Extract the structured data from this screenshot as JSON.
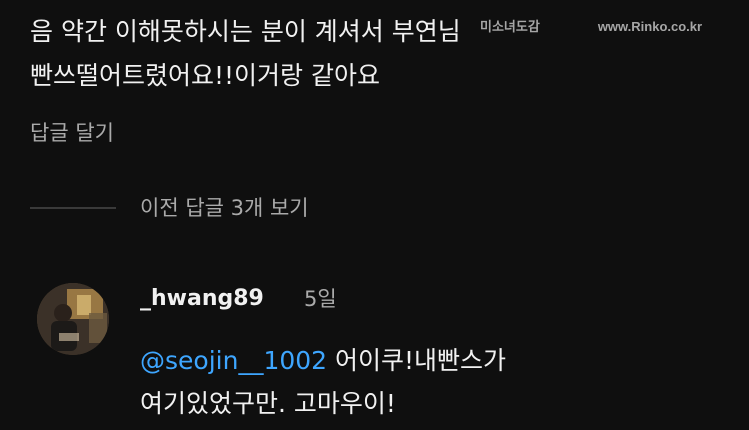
{
  "parent_comment": {
    "lines": [
      "음 약간 이해못하시는 분이 계셔서 부연님",
      "빤쓰떨어트렸어요!!이거랑 같아요"
    ],
    "reply_action": "답글 달기"
  },
  "watermark": {
    "left_text": "미소녀도감",
    "right_text": "www.Rinko.co.kr"
  },
  "replies_toggle": {
    "label": "이전 답글 3개 보기"
  },
  "reply": {
    "username": "_hwang89",
    "time": "5일",
    "mention": "@seojin__1002",
    "text_line1": " 어이쿠!내빤스가",
    "text_line2": "여기있었구만. 고마우이!"
  },
  "colors": {
    "background": "#0f0f0f",
    "text_primary": "#f1f1f1",
    "text_secondary": "#aaaaaa",
    "mention": "#3ea6ff"
  }
}
